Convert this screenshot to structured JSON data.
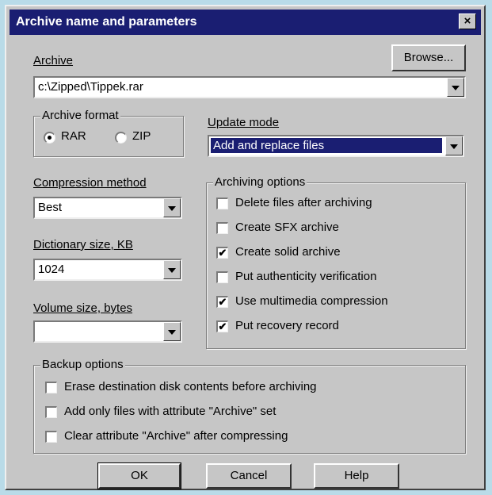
{
  "window": {
    "title": "Archive name and parameters",
    "close": "×"
  },
  "archive": {
    "label": "Archive",
    "browse": "Browse...",
    "path": "c:\\Zipped\\Tippek.rar"
  },
  "format": {
    "legend": "Archive format",
    "rar": "RAR",
    "zip": "ZIP",
    "selected": "RAR"
  },
  "update": {
    "label": "Update mode",
    "value": "Add and replace files"
  },
  "compression": {
    "label": "Compression method",
    "value": "Best"
  },
  "dictionary": {
    "label": "Dictionary size, KB",
    "value": "1024"
  },
  "volume": {
    "label": "Volume size, bytes",
    "value": ""
  },
  "archiving_options": {
    "legend": "Archiving options",
    "items": [
      {
        "label": "Delete files after archiving",
        "checked": false
      },
      {
        "label": "Create SFX archive",
        "checked": false
      },
      {
        "label": "Create solid archive",
        "checked": true
      },
      {
        "label": "Put authenticity verification",
        "checked": false
      },
      {
        "label": "Use multimedia compression",
        "checked": true
      },
      {
        "label": "Put recovery record",
        "checked": true
      }
    ]
  },
  "backup_options": {
    "legend": "Backup options",
    "items": [
      {
        "label": "Erase destination disk contents before archiving",
        "checked": false
      },
      {
        "label": "Add only files with attribute \"Archive\" set",
        "checked": false
      },
      {
        "label": "Clear attribute \"Archive\" after compressing",
        "checked": false
      }
    ]
  },
  "buttons": {
    "ok": "OK",
    "cancel": "Cancel",
    "help": "Help"
  },
  "checkmark": "✔"
}
